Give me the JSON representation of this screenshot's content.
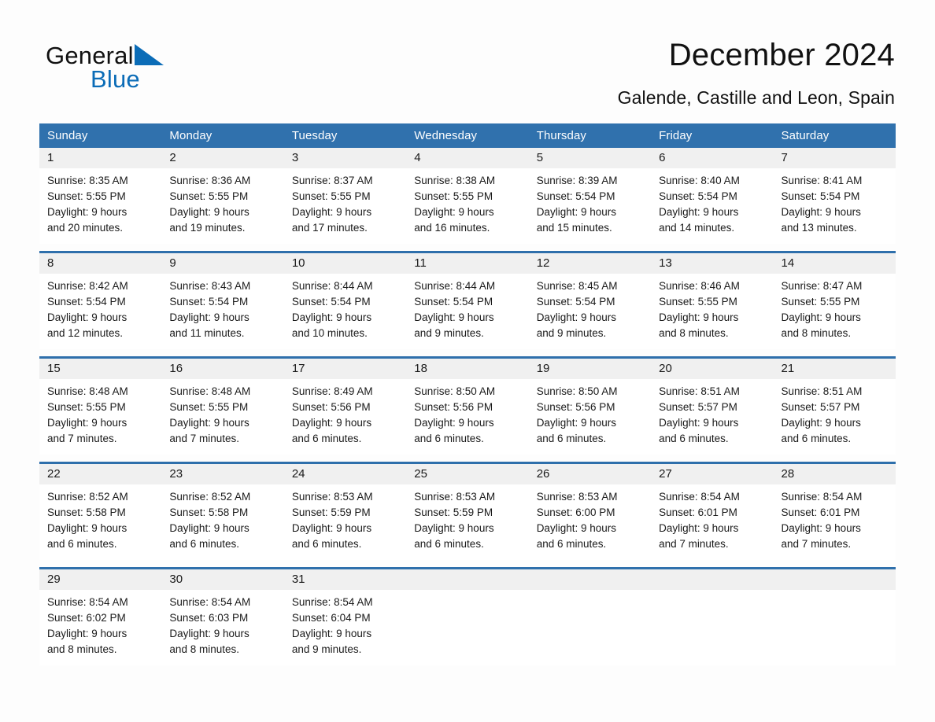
{
  "brand": {
    "name_line1": "General",
    "name_line2": "Blue",
    "triangle_icon": "triangle-logo-icon",
    "accent_color": "#0b6cb7"
  },
  "header": {
    "title": "December 2024",
    "subtitle": "Galende, Castille and Leon, Spain"
  },
  "theme": {
    "header_blue": "#3071ad",
    "row_rule_blue": "#2e6fab",
    "daynum_band": "#f0f0f0",
    "text": "#1a1a1a"
  },
  "weekdays": [
    "Sunday",
    "Monday",
    "Tuesday",
    "Wednesday",
    "Thursday",
    "Friday",
    "Saturday"
  ],
  "weeks": [
    {
      "days": [
        {
          "num": "1",
          "sunrise": "Sunrise: 8:35 AM",
          "sunset": "Sunset: 5:55 PM",
          "daylight1": "Daylight: 9 hours",
          "daylight2": "and 20 minutes."
        },
        {
          "num": "2",
          "sunrise": "Sunrise: 8:36 AM",
          "sunset": "Sunset: 5:55 PM",
          "daylight1": "Daylight: 9 hours",
          "daylight2": "and 19 minutes."
        },
        {
          "num": "3",
          "sunrise": "Sunrise: 8:37 AM",
          "sunset": "Sunset: 5:55 PM",
          "daylight1": "Daylight: 9 hours",
          "daylight2": "and 17 minutes."
        },
        {
          "num": "4",
          "sunrise": "Sunrise: 8:38 AM",
          "sunset": "Sunset: 5:55 PM",
          "daylight1": "Daylight: 9 hours",
          "daylight2": "and 16 minutes."
        },
        {
          "num": "5",
          "sunrise": "Sunrise: 8:39 AM",
          "sunset": "Sunset: 5:54 PM",
          "daylight1": "Daylight: 9 hours",
          "daylight2": "and 15 minutes."
        },
        {
          "num": "6",
          "sunrise": "Sunrise: 8:40 AM",
          "sunset": "Sunset: 5:54 PM",
          "daylight1": "Daylight: 9 hours",
          "daylight2": "and 14 minutes."
        },
        {
          "num": "7",
          "sunrise": "Sunrise: 8:41 AM",
          "sunset": "Sunset: 5:54 PM",
          "daylight1": "Daylight: 9 hours",
          "daylight2": "and 13 minutes."
        }
      ]
    },
    {
      "days": [
        {
          "num": "8",
          "sunrise": "Sunrise: 8:42 AM",
          "sunset": "Sunset: 5:54 PM",
          "daylight1": "Daylight: 9 hours",
          "daylight2": "and 12 minutes."
        },
        {
          "num": "9",
          "sunrise": "Sunrise: 8:43 AM",
          "sunset": "Sunset: 5:54 PM",
          "daylight1": "Daylight: 9 hours",
          "daylight2": "and 11 minutes."
        },
        {
          "num": "10",
          "sunrise": "Sunrise: 8:44 AM",
          "sunset": "Sunset: 5:54 PM",
          "daylight1": "Daylight: 9 hours",
          "daylight2": "and 10 minutes."
        },
        {
          "num": "11",
          "sunrise": "Sunrise: 8:44 AM",
          "sunset": "Sunset: 5:54 PM",
          "daylight1": "Daylight: 9 hours",
          "daylight2": "and 9 minutes."
        },
        {
          "num": "12",
          "sunrise": "Sunrise: 8:45 AM",
          "sunset": "Sunset: 5:54 PM",
          "daylight1": "Daylight: 9 hours",
          "daylight2": "and 9 minutes."
        },
        {
          "num": "13",
          "sunrise": "Sunrise: 8:46 AM",
          "sunset": "Sunset: 5:55 PM",
          "daylight1": "Daylight: 9 hours",
          "daylight2": "and 8 minutes."
        },
        {
          "num": "14",
          "sunrise": "Sunrise: 8:47 AM",
          "sunset": "Sunset: 5:55 PM",
          "daylight1": "Daylight: 9 hours",
          "daylight2": "and 8 minutes."
        }
      ]
    },
    {
      "days": [
        {
          "num": "15",
          "sunrise": "Sunrise: 8:48 AM",
          "sunset": "Sunset: 5:55 PM",
          "daylight1": "Daylight: 9 hours",
          "daylight2": "and 7 minutes."
        },
        {
          "num": "16",
          "sunrise": "Sunrise: 8:48 AM",
          "sunset": "Sunset: 5:55 PM",
          "daylight1": "Daylight: 9 hours",
          "daylight2": "and 7 minutes."
        },
        {
          "num": "17",
          "sunrise": "Sunrise: 8:49 AM",
          "sunset": "Sunset: 5:56 PM",
          "daylight1": "Daylight: 9 hours",
          "daylight2": "and 6 minutes."
        },
        {
          "num": "18",
          "sunrise": "Sunrise: 8:50 AM",
          "sunset": "Sunset: 5:56 PM",
          "daylight1": "Daylight: 9 hours",
          "daylight2": "and 6 minutes."
        },
        {
          "num": "19",
          "sunrise": "Sunrise: 8:50 AM",
          "sunset": "Sunset: 5:56 PM",
          "daylight1": "Daylight: 9 hours",
          "daylight2": "and 6 minutes."
        },
        {
          "num": "20",
          "sunrise": "Sunrise: 8:51 AM",
          "sunset": "Sunset: 5:57 PM",
          "daylight1": "Daylight: 9 hours",
          "daylight2": "and 6 minutes."
        },
        {
          "num": "21",
          "sunrise": "Sunrise: 8:51 AM",
          "sunset": "Sunset: 5:57 PM",
          "daylight1": "Daylight: 9 hours",
          "daylight2": "and 6 minutes."
        }
      ]
    },
    {
      "days": [
        {
          "num": "22",
          "sunrise": "Sunrise: 8:52 AM",
          "sunset": "Sunset: 5:58 PM",
          "daylight1": "Daylight: 9 hours",
          "daylight2": "and 6 minutes."
        },
        {
          "num": "23",
          "sunrise": "Sunrise: 8:52 AM",
          "sunset": "Sunset: 5:58 PM",
          "daylight1": "Daylight: 9 hours",
          "daylight2": "and 6 minutes."
        },
        {
          "num": "24",
          "sunrise": "Sunrise: 8:53 AM",
          "sunset": "Sunset: 5:59 PM",
          "daylight1": "Daylight: 9 hours",
          "daylight2": "and 6 minutes."
        },
        {
          "num": "25",
          "sunrise": "Sunrise: 8:53 AM",
          "sunset": "Sunset: 5:59 PM",
          "daylight1": "Daylight: 9 hours",
          "daylight2": "and 6 minutes."
        },
        {
          "num": "26",
          "sunrise": "Sunrise: 8:53 AM",
          "sunset": "Sunset: 6:00 PM",
          "daylight1": "Daylight: 9 hours",
          "daylight2": "and 6 minutes."
        },
        {
          "num": "27",
          "sunrise": "Sunrise: 8:54 AM",
          "sunset": "Sunset: 6:01 PM",
          "daylight1": "Daylight: 9 hours",
          "daylight2": "and 7 minutes."
        },
        {
          "num": "28",
          "sunrise": "Sunrise: 8:54 AM",
          "sunset": "Sunset: 6:01 PM",
          "daylight1": "Daylight: 9 hours",
          "daylight2": "and 7 minutes."
        }
      ]
    },
    {
      "days": [
        {
          "num": "29",
          "sunrise": "Sunrise: 8:54 AM",
          "sunset": "Sunset: 6:02 PM",
          "daylight1": "Daylight: 9 hours",
          "daylight2": "and 8 minutes."
        },
        {
          "num": "30",
          "sunrise": "Sunrise: 8:54 AM",
          "sunset": "Sunset: 6:03 PM",
          "daylight1": "Daylight: 9 hours",
          "daylight2": "and 8 minutes."
        },
        {
          "num": "31",
          "sunrise": "Sunrise: 8:54 AM",
          "sunset": "Sunset: 6:04 PM",
          "daylight1": "Daylight: 9 hours",
          "daylight2": "and 9 minutes."
        },
        {
          "num": "",
          "sunrise": "",
          "sunset": "",
          "daylight1": "",
          "daylight2": ""
        },
        {
          "num": "",
          "sunrise": "",
          "sunset": "",
          "daylight1": "",
          "daylight2": ""
        },
        {
          "num": "",
          "sunrise": "",
          "sunset": "",
          "daylight1": "",
          "daylight2": ""
        },
        {
          "num": "",
          "sunrise": "",
          "sunset": "",
          "daylight1": "",
          "daylight2": ""
        }
      ]
    }
  ]
}
